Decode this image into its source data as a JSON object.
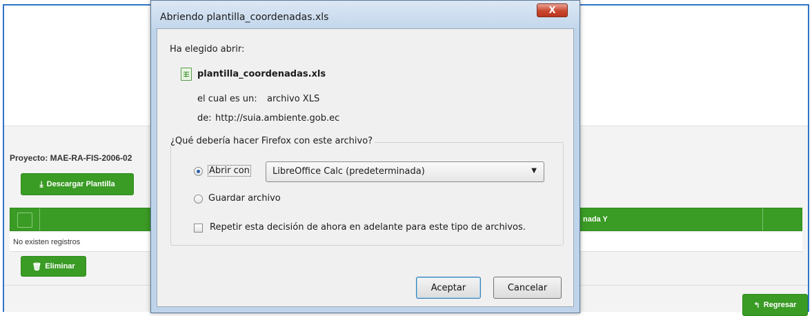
{
  "page": {
    "project_label": "Proyecto: MAE-RA-FIS-2006-02",
    "download_button": "Descargar Plantilla",
    "table": {
      "columns": [
        "",
        "nada Y"
      ],
      "empty_message": "No existen registros"
    },
    "delete_button": "Eliminar",
    "back_button": "Regresar",
    "accent_color": "#3a9b25"
  },
  "dialog": {
    "title": "Abriendo plantilla_coordenadas.xls",
    "close_label": "X",
    "chosen_label": "Ha elegido abrir:",
    "file_name": "plantilla_coordenadas.xls",
    "file_icon": "spreadsheet-file-icon",
    "type_label": "el cual es un:",
    "type_value": "archivo XLS",
    "from_label": "de:",
    "from_value": "http://suia.ambiente.gob.ec",
    "question": "¿Qué debería hacer Firefox con este archivo?",
    "options": {
      "open_with_label": "Abrir con",
      "open_with_app": "LibreOffice Calc (predeterminada)",
      "open_with_selected": true,
      "save_label": "Guardar archivo",
      "save_selected": false
    },
    "remember_label": "Repetir esta decisión de ahora en adelante para este tipo de archivos.",
    "remember_checked": false,
    "ok_button": "Aceptar",
    "cancel_button": "Cancelar"
  }
}
